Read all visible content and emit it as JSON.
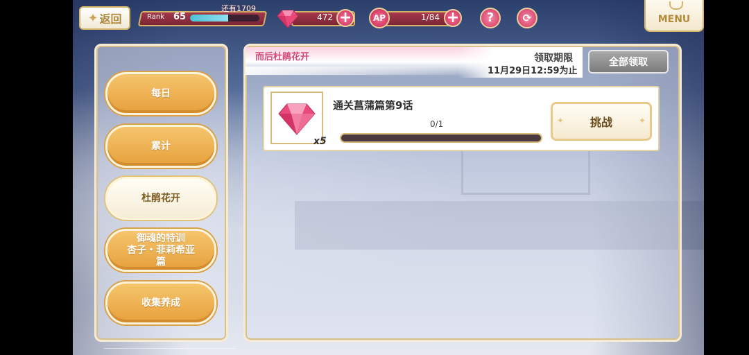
{
  "topbar": {
    "back_label": "返回",
    "rank_label": "Rank",
    "rank_value": "65",
    "rank_remaining": "还有1709",
    "rank_progress": 0.55,
    "gems_value": "472",
    "ap_label": "AP",
    "ap_value": "1/84",
    "help_symbol": "?",
    "menu_label": "MENU"
  },
  "sidebar": {
    "tabs": [
      {
        "label": "每日"
      },
      {
        "label": "累计"
      },
      {
        "label": "杜鹃花开"
      },
      {
        "label": "御魂的特训\n杏子・菲莉希亚\n篇"
      },
      {
        "label": "收集养成"
      }
    ],
    "active_index": 2
  },
  "main": {
    "section_title": "而后杜鹃花开",
    "deadline_label": "领取期限",
    "deadline_date": "11月29日12:59为止",
    "claim_all_label": "全部领取",
    "missions": [
      {
        "title": "通关菖蒲篇第9话",
        "reward_icon": "gem-icon",
        "reward_count": "x5",
        "progress_text": "0/1",
        "progress": 0,
        "action_label": "挑战"
      }
    ]
  },
  "colors": {
    "accent_gold": "#d4b36b",
    "tab_orange": "#e7a03c",
    "title_pink": "#d24b76",
    "resource_red": "#7d2535"
  }
}
